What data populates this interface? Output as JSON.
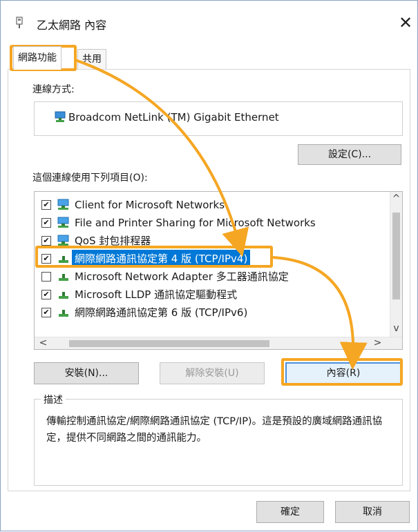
{
  "window": {
    "title": "乙太網路 內容",
    "close_glyph": "✕"
  },
  "tabs": [
    {
      "label": "網路功能",
      "active": true
    },
    {
      "label": "共用",
      "active": false
    }
  ],
  "connect_using": {
    "label": "連線方式:",
    "adapter": "Broadcom NetLink (TM) Gigabit Ethernet",
    "configure_button": "設定(C)..."
  },
  "items": {
    "label": "這個連線使用下列項目(O):",
    "list": [
      {
        "text": "Client for Microsoft Networks",
        "checked": true,
        "icon": "network-client-icon"
      },
      {
        "text": "File and Printer Sharing for Microsoft Networks",
        "checked": true,
        "icon": "network-client-icon"
      },
      {
        "text": "QoS 封包排程器",
        "checked": true,
        "icon": "network-client-icon"
      },
      {
        "text": "網際網路通訊協定第 4 版 (TCP/IPv4)",
        "checked": true,
        "icon": "protocol-icon",
        "selected": true
      },
      {
        "text": "Microsoft Network Adapter 多工器通訊協定",
        "checked": false,
        "icon": "protocol-icon"
      },
      {
        "text": "Microsoft LLDP 通訊協定驅動程式",
        "checked": true,
        "icon": "protocol-icon"
      },
      {
        "text": "網際網路通訊協定第 6 版 (TCP/IPv6)",
        "checked": true,
        "icon": "protocol-icon"
      }
    ],
    "check_glyph": "✔"
  },
  "buttons": {
    "install": "安裝(N)...",
    "uninstall": "解除安裝(U)",
    "properties": "內容(R)",
    "ok": "確定",
    "cancel": "取消"
  },
  "description": {
    "legend": "描述",
    "text": "傳輸控制通訊協定/網際網路通訊協定 (TCP/IP)。這是預設的廣域網路通訊協定，提供不同網路之間的通訊能力。"
  },
  "scroll": {
    "up": "^",
    "down": "v",
    "left": "<",
    "right": ">"
  },
  "colors": {
    "highlight": "#f5a623",
    "selection": "#0078d7"
  }
}
